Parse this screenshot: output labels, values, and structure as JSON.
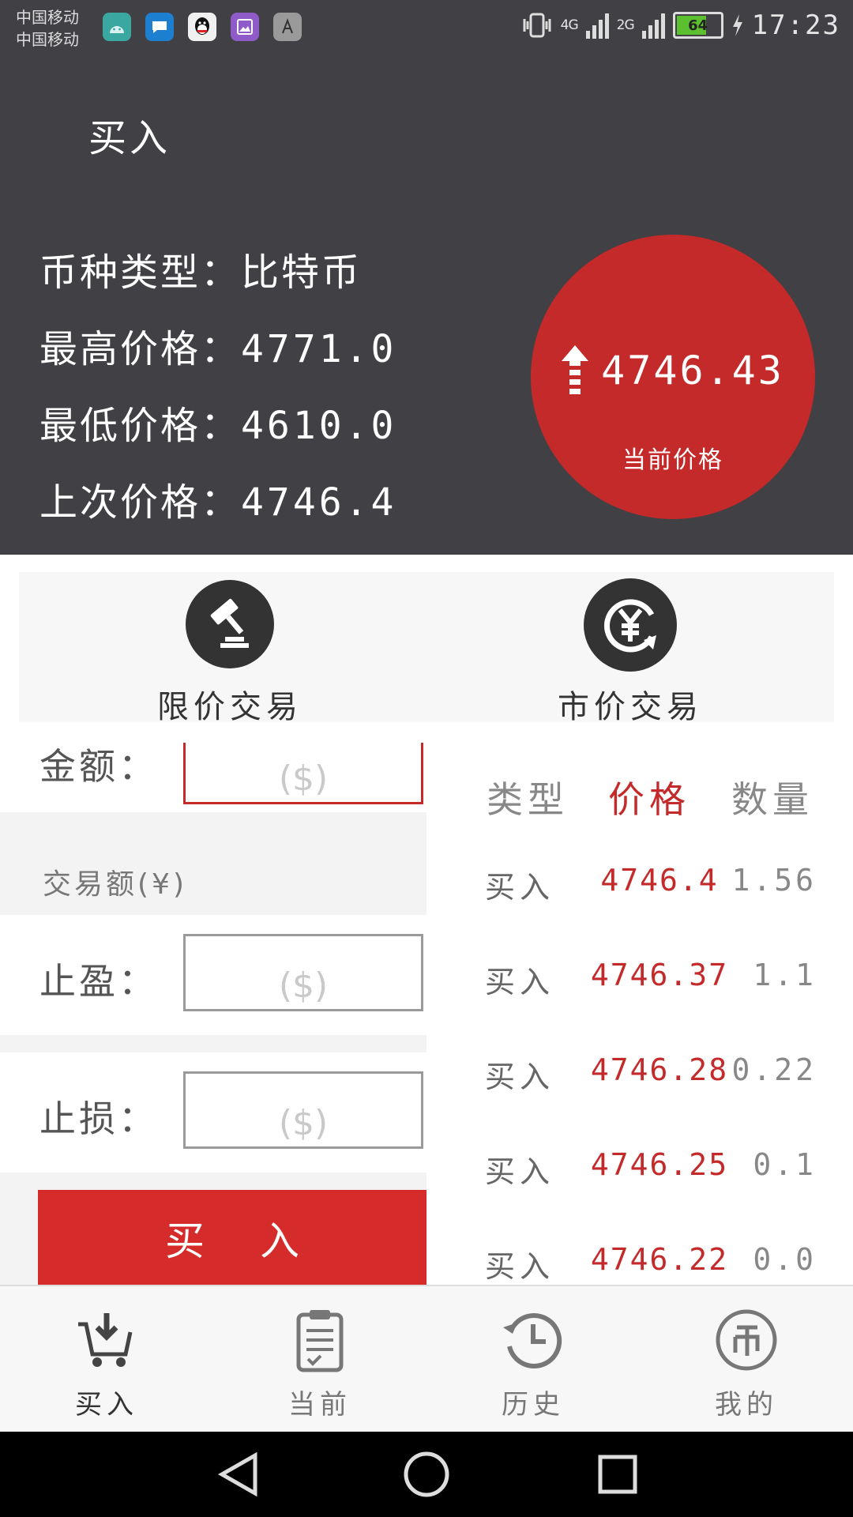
{
  "status_bar": {
    "carrier1": "中国移动",
    "carrier2": "中国移动",
    "signal1": "4G",
    "signal2": "2G",
    "battery": "64",
    "time": "17:23"
  },
  "header": {
    "title": "买入",
    "coin_type_label": "币种类型：",
    "coin_type_value": "比特币",
    "high_label": "最高价格：",
    "high_value": "4771.0",
    "low_label": "最低价格：",
    "low_value": "4610.0",
    "last_label": "上次价格：",
    "last_value": "4746.4",
    "current_price": "4746.43",
    "current_price_label": "当前价格"
  },
  "trade_types": {
    "limit_label": "限价交易",
    "market_label": "市价交易"
  },
  "form": {
    "amount_label": "金额：",
    "amount_placeholder": "($)",
    "trade_amount_label": "交易额(¥)",
    "take_profit_label": "止盈：",
    "take_profit_placeholder": "($)",
    "stop_loss_label": "止损：",
    "stop_loss_placeholder": "($)",
    "buy_button": "买入"
  },
  "order_book": {
    "headers": {
      "type": "类型",
      "price": "价格",
      "quantity": "数量"
    },
    "rows": [
      {
        "type": "买入",
        "price": "4746.4",
        "quantity": "1.56"
      },
      {
        "type": "买入",
        "price": "4746.37",
        "quantity": "1.1"
      },
      {
        "type": "买入",
        "price": "4746.28",
        "quantity": "0.22"
      },
      {
        "type": "买入",
        "price": "4746.25",
        "quantity": "0.1"
      },
      {
        "type": "买入",
        "price": "4746.22",
        "quantity": "0.0"
      }
    ]
  },
  "tabs": [
    {
      "label": "买入",
      "icon": "cart-download-icon",
      "active": true
    },
    {
      "label": "当前",
      "icon": "clipboard-icon",
      "active": false
    },
    {
      "label": "历史",
      "icon": "history-clock-icon",
      "active": false
    },
    {
      "label": "我的",
      "icon": "coin-icon",
      "active": false
    }
  ],
  "colors": {
    "header_bg": "#414045",
    "accent_red": "#c42a2a",
    "buy_button": "#d62b2b"
  }
}
